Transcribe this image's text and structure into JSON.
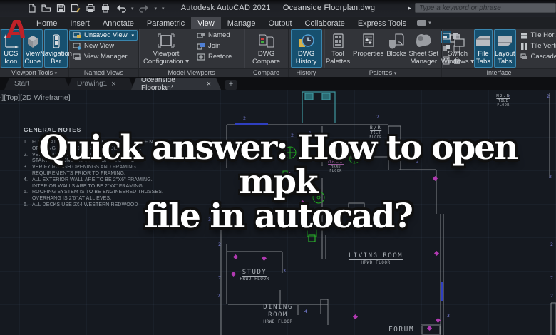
{
  "titlebar": {
    "app": "Autodesk AutoCAD 2021",
    "doc": "Oceanside Floorplan.dwg",
    "search_placeholder": "Type a keyword or phrase"
  },
  "icons": {
    "caret": "▾",
    "search_arrow": "▸",
    "close": "×",
    "plus": "+"
  },
  "colors": {
    "highlight_blue": "#17506f",
    "logo_red": "#bf2228",
    "wall_gray": "#84878c",
    "cad_teal": "#3f98a0",
    "cad_green": "#22a822",
    "cad_magenta": "#b23ab2",
    "cad_blue": "#2f3fc0",
    "cad_purple": "#7b80da"
  },
  "ribbon": {
    "tabs": [
      "Home",
      "Insert",
      "Annotate",
      "Parametric",
      "View",
      "Manage",
      "Output",
      "Collaborate",
      "Express Tools"
    ],
    "active_tab": "View",
    "viewport_tools": {
      "label": "Viewport Tools",
      "buttons": [
        {
          "l1": "UCS",
          "l2": "Icon"
        },
        {
          "l1": "View",
          "l2": "Cube"
        },
        {
          "l1": "Navigation",
          "l2": "Bar"
        }
      ]
    },
    "named_views": {
      "label": "Named Views",
      "rows": [
        "Unsaved View",
        "New View",
        "View Manager"
      ]
    },
    "model_viewports": {
      "label": "Model Viewports",
      "big": {
        "l1": "Viewport",
        "l2": "Configuration"
      },
      "rows": [
        "Named",
        "Join",
        "Restore"
      ]
    },
    "compare": {
      "label": "Compare",
      "big": {
        "l1": "DWG",
        "l2": "Compare"
      }
    },
    "history": {
      "label": "History",
      "big": {
        "l1": "DWG",
        "l2": "History"
      }
    },
    "palettes": {
      "label": "Palettes",
      "buttons": [
        {
          "l1": "Tool",
          "l2": "Palettes"
        },
        {
          "l1": "Properties",
          "l2": ""
        },
        {
          "l1": "Blocks",
          "l2": ""
        },
        {
          "l1": "Sheet Set",
          "l2": "Manager"
        }
      ]
    },
    "interface": {
      "label": "Interface",
      "buttons": [
        {
          "l1": "Switch",
          "l2": "Windows"
        },
        {
          "l1": "File",
          "l2": "Tabs"
        },
        {
          "l1": "Layout",
          "l2": "Tabs"
        }
      ],
      "rows": [
        "Tile Horizontally",
        "Tile Vertically",
        "Cascade"
      ]
    }
  },
  "filetabs": {
    "tabs": [
      "Start",
      "Drawing1",
      "Oceanside Floorplan*"
    ]
  },
  "canvas": {
    "viewport_label": "[-][Top][2D Wireframe]",
    "overlay_line1": "Quick answer: How to open mpk",
    "overlay_line2": "file in autocad?",
    "notes_title": "GENERAL NOTES",
    "notes": [
      {
        "n": "1.",
        "t": "FOUNDATION VENTILATION EQUAL TO 1 SF OF NET."
      },
      {
        "n": "",
        "t": "OPENING FOR EACH 150 SF UNDER FLOOR."
      },
      {
        "n": "2.",
        "t": "VERIFY ALL DIMENSIONS PRIOR TO"
      },
      {
        "n": "",
        "t": "STARTING CONSTRUCTION ON BUILDING."
      },
      {
        "n": "3.",
        "t": "VERIFY ROUGH OPENINGS AND FRAMING"
      },
      {
        "n": "",
        "t": "REQUIREMENTS PRIOR TO FRAMING."
      },
      {
        "n": "4.",
        "t": "ALL EXTERIOR WALL ARE TO BE 2\"X6\" FRAMING."
      },
      {
        "n": "",
        "t": "INTERIOR WALLS ARE TO BE 2\"X4\" FRAMING."
      },
      {
        "n": "5.",
        "t": "ROOFING SYSTEM IS TO BE ENGINEERED TRUSSES."
      },
      {
        "n": "",
        "t": "OVERHANG IS 2'6\" AT ALL EVES."
      },
      {
        "n": "6.",
        "t": "ALL DECKS USE 2X4 WESTERN REDWOOD"
      }
    ],
    "rooms": {
      "br": {
        "name": "B/R",
        "f1": "TILE",
        "f2": "FLOOR"
      },
      "m2r": {
        "name": "M2.R",
        "f1": "TILE",
        "f2": "FLOOR"
      },
      "hall": {
        "name": "HALL",
        "f1": "HRWD",
        "f2": "FLOOR"
      },
      "living": {
        "name": "LIVING ROOM",
        "f1": "HRWD FLOOR"
      },
      "study": {
        "name": "STUDY",
        "f1": "HRWD FLOOR"
      },
      "dining": {
        "name": "DINING",
        "name2": "ROOM",
        "f1": "HRWD FLOOR"
      },
      "forum": {
        "name": "FORUM"
      }
    },
    "numbers": [
      "2",
      "2",
      "1",
      "2",
      "1",
      "3",
      "2",
      "7",
      "2",
      "3",
      "4",
      "3",
      "2",
      "7",
      "2",
      "2",
      "1",
      "2"
    ]
  }
}
